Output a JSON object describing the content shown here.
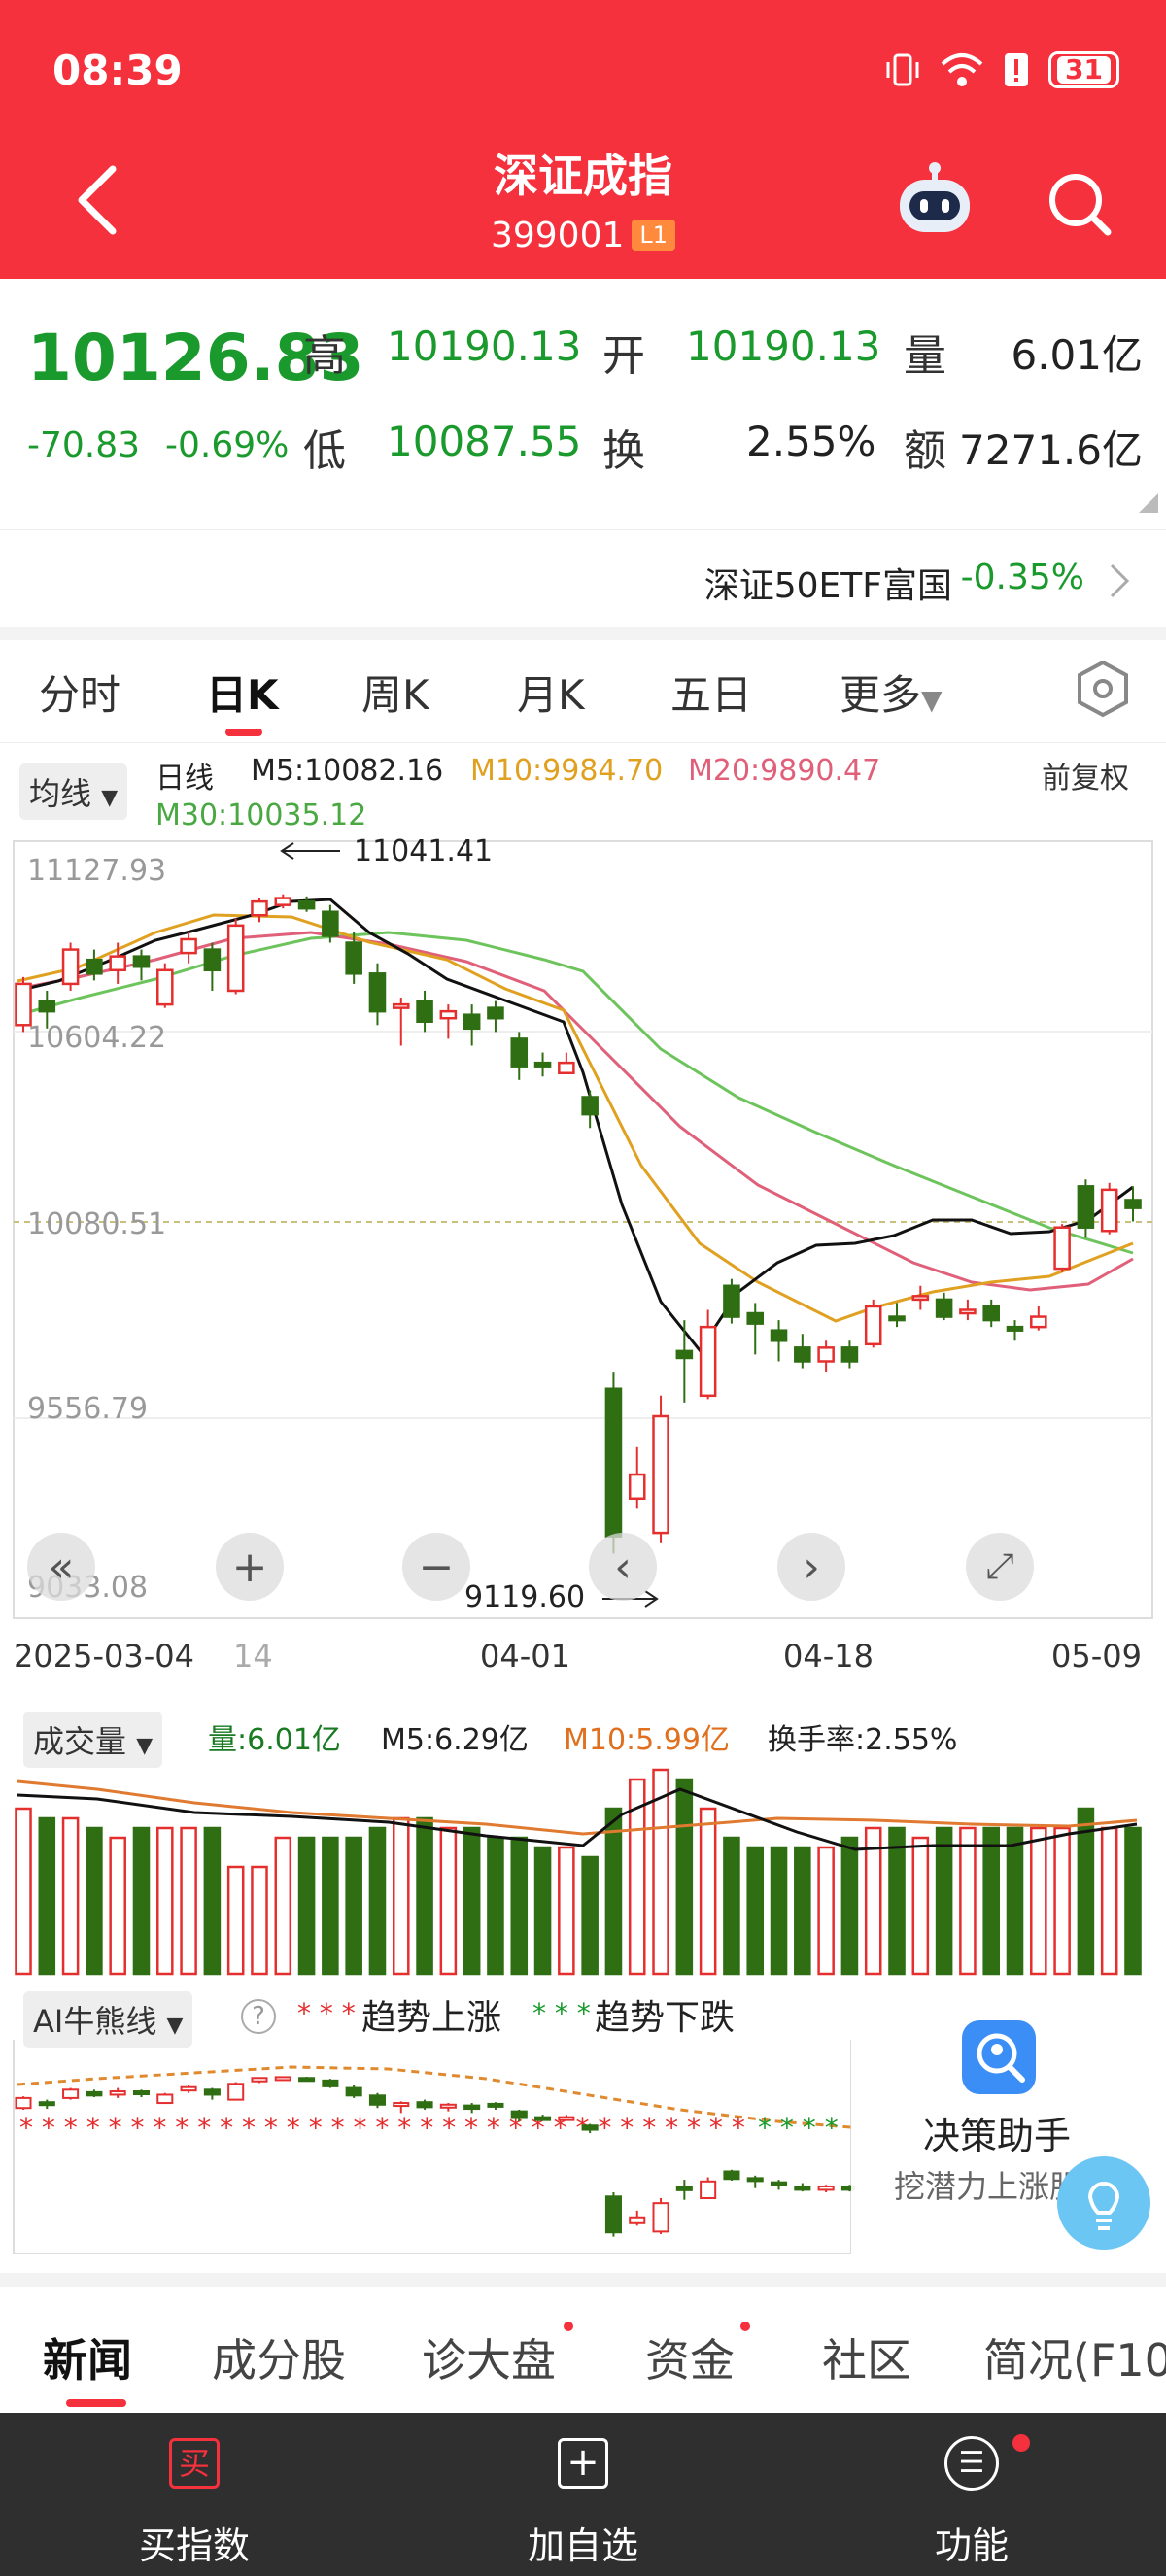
{
  "status_bar": {
    "time": "08:39",
    "battery": "31"
  },
  "header": {
    "title": "深证成指",
    "code": "399001",
    "level": "L1"
  },
  "quote": {
    "price": "10126.83",
    "change": "-70.83",
    "change_pct": "-0.69%",
    "high_label": "高",
    "high": "10190.13",
    "open_label": "开",
    "open": "10190.13",
    "volume_label": "量",
    "volume": "6.01亿",
    "low_label": "低",
    "low": "10087.55",
    "turnover_label": "换",
    "turnover": "2.55%",
    "amount_label": "额",
    "amount": "7271.6亿"
  },
  "etf": {
    "name": "深证50ETF富国",
    "change": "-0.35%"
  },
  "tabs": [
    "分时",
    "日K",
    "周K",
    "月K",
    "五日",
    "更多"
  ],
  "active_tab": "日K",
  "indicator": {
    "chip": "均线",
    "period": "日线",
    "m5": "M5:10082.16",
    "m10": "M10:9984.70",
    "m20": "M20:9890.47",
    "m30": "M30:10035.12",
    "adjust": "前复权"
  },
  "chart_data": {
    "type": "candlestick",
    "y_ticks": [
      "11127.93",
      "10604.22",
      "10080.51",
      "9556.79",
      "9033.08"
    ],
    "ylim": [
      9033.08,
      11127.93
    ],
    "x_ticks": [
      "2025-03-04",
      "14",
      "04-01",
      "04-18",
      "05-09"
    ],
    "max_annotation": "11041.41",
    "min_annotation": "9119.60",
    "ma_colors": {
      "m5": "#111111",
      "m10": "#e0a020",
      "m20": "#e0607a",
      "m30": "#6ec45c"
    },
    "candles": [
      [
        10660,
        10780,
        10640,
        10800
      ],
      [
        10730,
        10700,
        10650,
        10760
      ],
      [
        10780,
        10880,
        10760,
        10900
      ],
      [
        10850,
        10810,
        10790,
        10880
      ],
      [
        10820,
        10860,
        10780,
        10900
      ],
      [
        10860,
        10830,
        10790,
        10880
      ],
      [
        10720,
        10820,
        10710,
        10840
      ],
      [
        10870,
        10910,
        10840,
        10930
      ],
      [
        10880,
        10820,
        10760,
        10900
      ],
      [
        10760,
        10950,
        10750,
        10970
      ],
      [
        10980,
        11020,
        10960,
        11030
      ],
      [
        11010,
        11030,
        11000,
        11041
      ],
      [
        11020,
        11000,
        10990,
        11035
      ],
      [
        10990,
        10920,
        10900,
        11010
      ],
      [
        10900,
        10810,
        10780,
        10930
      ],
      [
        10810,
        10700,
        10660,
        10840
      ],
      [
        10710,
        10720,
        10600,
        10740
      ],
      [
        10730,
        10670,
        10640,
        10760
      ],
      [
        10680,
        10700,
        10620,
        10720
      ],
      [
        10690,
        10650,
        10600,
        10720
      ],
      [
        10710,
        10680,
        10640,
        10730
      ],
      [
        10620,
        10540,
        10500,
        10640
      ],
      [
        10550,
        10540,
        10510,
        10580
      ],
      [
        10520,
        10550,
        10520,
        10580
      ],
      [
        10450,
        10400,
        10360,
        10470
      ],
      [
        9600,
        9170,
        9119.6,
        9650
      ],
      [
        9280,
        9350,
        9250,
        9430
      ],
      [
        9180,
        9520,
        9150,
        9580
      ],
      [
        9710,
        9690,
        9560,
        9800
      ],
      [
        9580,
        9780,
        9570,
        9830
      ],
      [
        9900,
        9810,
        9790,
        9920
      ],
      [
        9820,
        9790,
        9700,
        9850
      ],
      [
        9770,
        9740,
        9680,
        9800
      ],
      [
        9720,
        9680,
        9660,
        9760
      ],
      [
        9680,
        9720,
        9650,
        9740
      ],
      [
        9720,
        9680,
        9660,
        9740
      ],
      [
        9730,
        9840,
        9720,
        9860
      ],
      [
        9810,
        9800,
        9780,
        9850
      ],
      [
        9860,
        9870,
        9830,
        9900
      ],
      [
        9860,
        9810,
        9800,
        9880
      ],
      [
        9820,
        9830,
        9800,
        9860
      ],
      [
        9840,
        9800,
        9780,
        9860
      ],
      [
        9780,
        9770,
        9740,
        9800
      ],
      [
        9780,
        9810,
        9770,
        9840
      ],
      [
        9950,
        10070,
        9940,
        10080
      ],
      [
        10190,
        10070,
        10040,
        10210
      ],
      [
        10060,
        10180,
        10050,
        10200
      ],
      [
        10150,
        10126.83,
        10087.55,
        10190.13
      ]
    ]
  },
  "volume": {
    "chip": "成交量",
    "vol": "量:6.01亿",
    "m5": "M5:6.29亿",
    "m10": "M10:5.99亿",
    "turnover": "换手率:2.55%"
  },
  "ai": {
    "chip": "AI牛熊线",
    "help": "?",
    "up": "趋势上涨",
    "down": "趋势下跌",
    "assistant_title": "决策助手",
    "assistant_sub": "挖潜力上涨股"
  },
  "news_tabs": [
    "新闻",
    "成分股",
    "诊大盘",
    "资金",
    "社区",
    "简况(F10"
  ],
  "bottom_bar": [
    {
      "label": "买指数",
      "icon": "买"
    },
    {
      "label": "加自选",
      "icon": "+"
    },
    {
      "label": "功能",
      "icon": "☰"
    }
  ]
}
